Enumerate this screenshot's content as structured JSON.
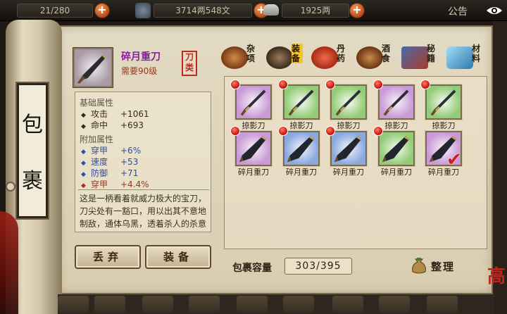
{
  "topbar": {
    "stamina": "21/280",
    "copper": "3714两548文",
    "silver": "1925两",
    "announcement": "公告"
  },
  "sidebar": {
    "title_chars": [
      "包",
      "裹"
    ]
  },
  "seal_char": "高",
  "item": {
    "name": "碎月重刀",
    "requirement": "需要90级",
    "type_badge": "刀类",
    "base_section": "基础属性",
    "base_stats": [
      {
        "name": "攻击",
        "value": "+1061"
      },
      {
        "name": "命中",
        "value": "+693"
      }
    ],
    "extra_section": "附加属性",
    "extra_stats": [
      {
        "name": "穿甲",
        "value": "+6%"
      },
      {
        "name": "速度",
        "value": "+53"
      },
      {
        "name": "防御",
        "value": "+71"
      },
      {
        "name": "穿甲",
        "value": "+4.4%"
      }
    ],
    "description": "这是一柄看着就威力极大的宝刀，刀尖处有一豁口，用以出其不意地制敌，通体乌黑，透着杀人的杀意"
  },
  "actions": {
    "discard": "丢弃",
    "equip": "装备"
  },
  "tabs": [
    {
      "label": "杂项",
      "active": false
    },
    {
      "label": "装备",
      "active": true
    },
    {
      "label": "丹药",
      "active": false
    },
    {
      "label": "酒食",
      "active": false
    },
    {
      "label": "秘籍",
      "active": false
    },
    {
      "label": "材料",
      "active": false
    }
  ],
  "inventory": [
    {
      "label": "掠影刀",
      "quality": "purple",
      "new": true,
      "equipped": false
    },
    {
      "label": "掠影刀",
      "quality": "green",
      "new": true,
      "equipped": false
    },
    {
      "label": "掠影刀",
      "quality": "green",
      "new": true,
      "equipped": false
    },
    {
      "label": "掠影刀",
      "quality": "purple",
      "new": true,
      "equipped": false
    },
    {
      "label": "掠影刀",
      "quality": "green",
      "new": true,
      "equipped": false
    },
    {
      "label": "碎月重刀",
      "quality": "purple",
      "new": true,
      "equipped": false
    },
    {
      "label": "碎月重刀",
      "quality": "blue",
      "new": true,
      "equipped": false
    },
    {
      "label": "碎月重刀",
      "quality": "blue",
      "new": true,
      "equipped": false
    },
    {
      "label": "碎月重刀",
      "quality": "green",
      "new": true,
      "equipped": false
    },
    {
      "label": "碎月重刀",
      "quality": "purple",
      "new": false,
      "equipped": true
    }
  ],
  "capacity": {
    "label": "包裹容量",
    "value": "303/395"
  },
  "organize_label": "整理",
  "colors": {
    "item_name": "#8a1fa6",
    "requirement": "#a5321e",
    "extra_attr_red": "#a5321e",
    "extra_attr_blue": "#2f4f9a"
  }
}
